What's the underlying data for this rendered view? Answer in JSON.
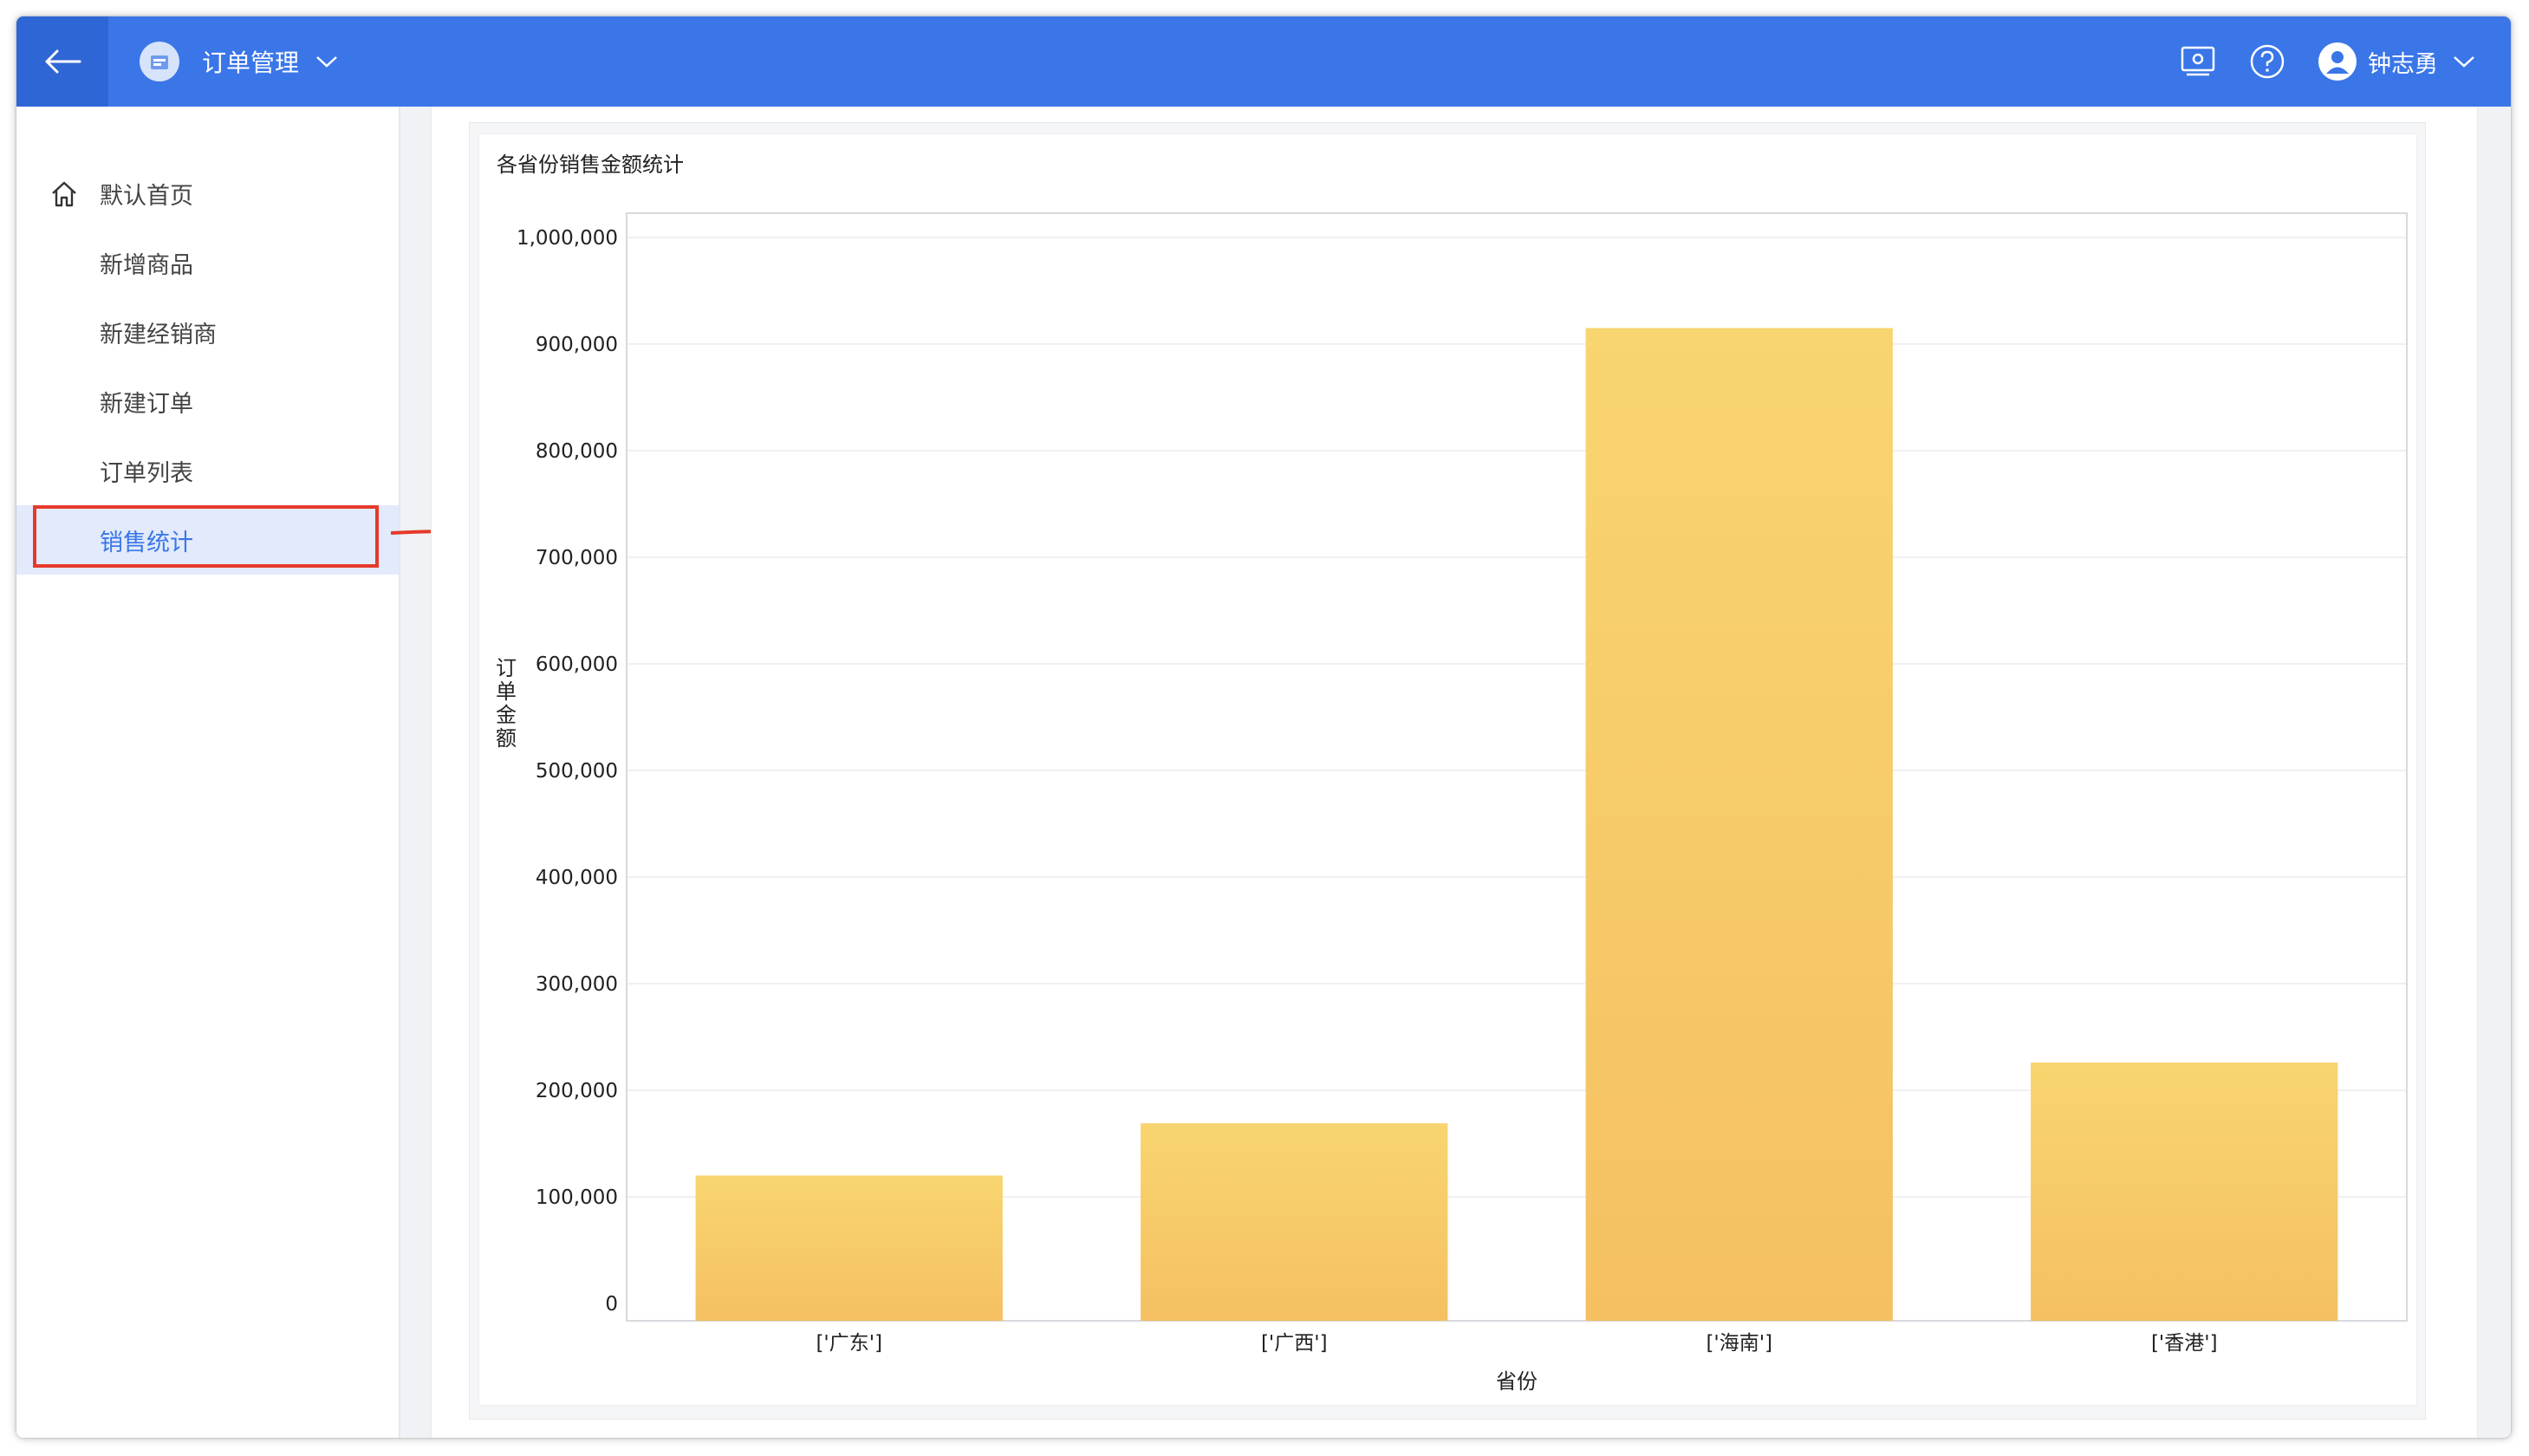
{
  "header": {
    "app_title": "订单管理",
    "user_name": "钟志勇",
    "icons": [
      "back-arrow-icon",
      "app-logo-icon",
      "chevron-down-icon",
      "screen-capture-icon",
      "help-icon",
      "user-avatar-icon",
      "chevron-down-icon"
    ]
  },
  "sidebar": {
    "items": [
      {
        "label": "默认首页",
        "icon": "home-icon",
        "active": false
      },
      {
        "label": "新增商品",
        "active": false
      },
      {
        "label": "新建经销商",
        "active": false
      },
      {
        "label": "新建订单",
        "active": false
      },
      {
        "label": "订单列表",
        "active": false
      },
      {
        "label": "销售统计",
        "active": true
      }
    ]
  },
  "colors": {
    "header_bg": "#3a76e8",
    "active_item_bg": "#e2eafb",
    "active_item_text": "#3a76e8",
    "annotation_red": "#e53a2a",
    "bar_top": "#f8d56f",
    "bar_bottom": "#f5c062"
  },
  "chart_data": {
    "type": "bar",
    "title": "各省份销售金额统计",
    "xlabel": "省份",
    "ylabel": "订单金额",
    "categories": [
      "['广东']",
      "['广西']",
      "['海南']",
      "['香港']"
    ],
    "values": [
      120000,
      169000,
      915000,
      226000
    ],
    "ylim": [
      0,
      1000000
    ],
    "yticks": [
      0,
      100000,
      200000,
      300000,
      400000,
      500000,
      600000,
      700000,
      800000,
      900000,
      1000000
    ],
    "ytick_labels": [
      "0",
      "100,000",
      "200,000",
      "300,000",
      "400,000",
      "500,000",
      "600,000",
      "700,000",
      "800,000",
      "900,000",
      "1,000,000"
    ],
    "grid": true,
    "legend": "none"
  }
}
